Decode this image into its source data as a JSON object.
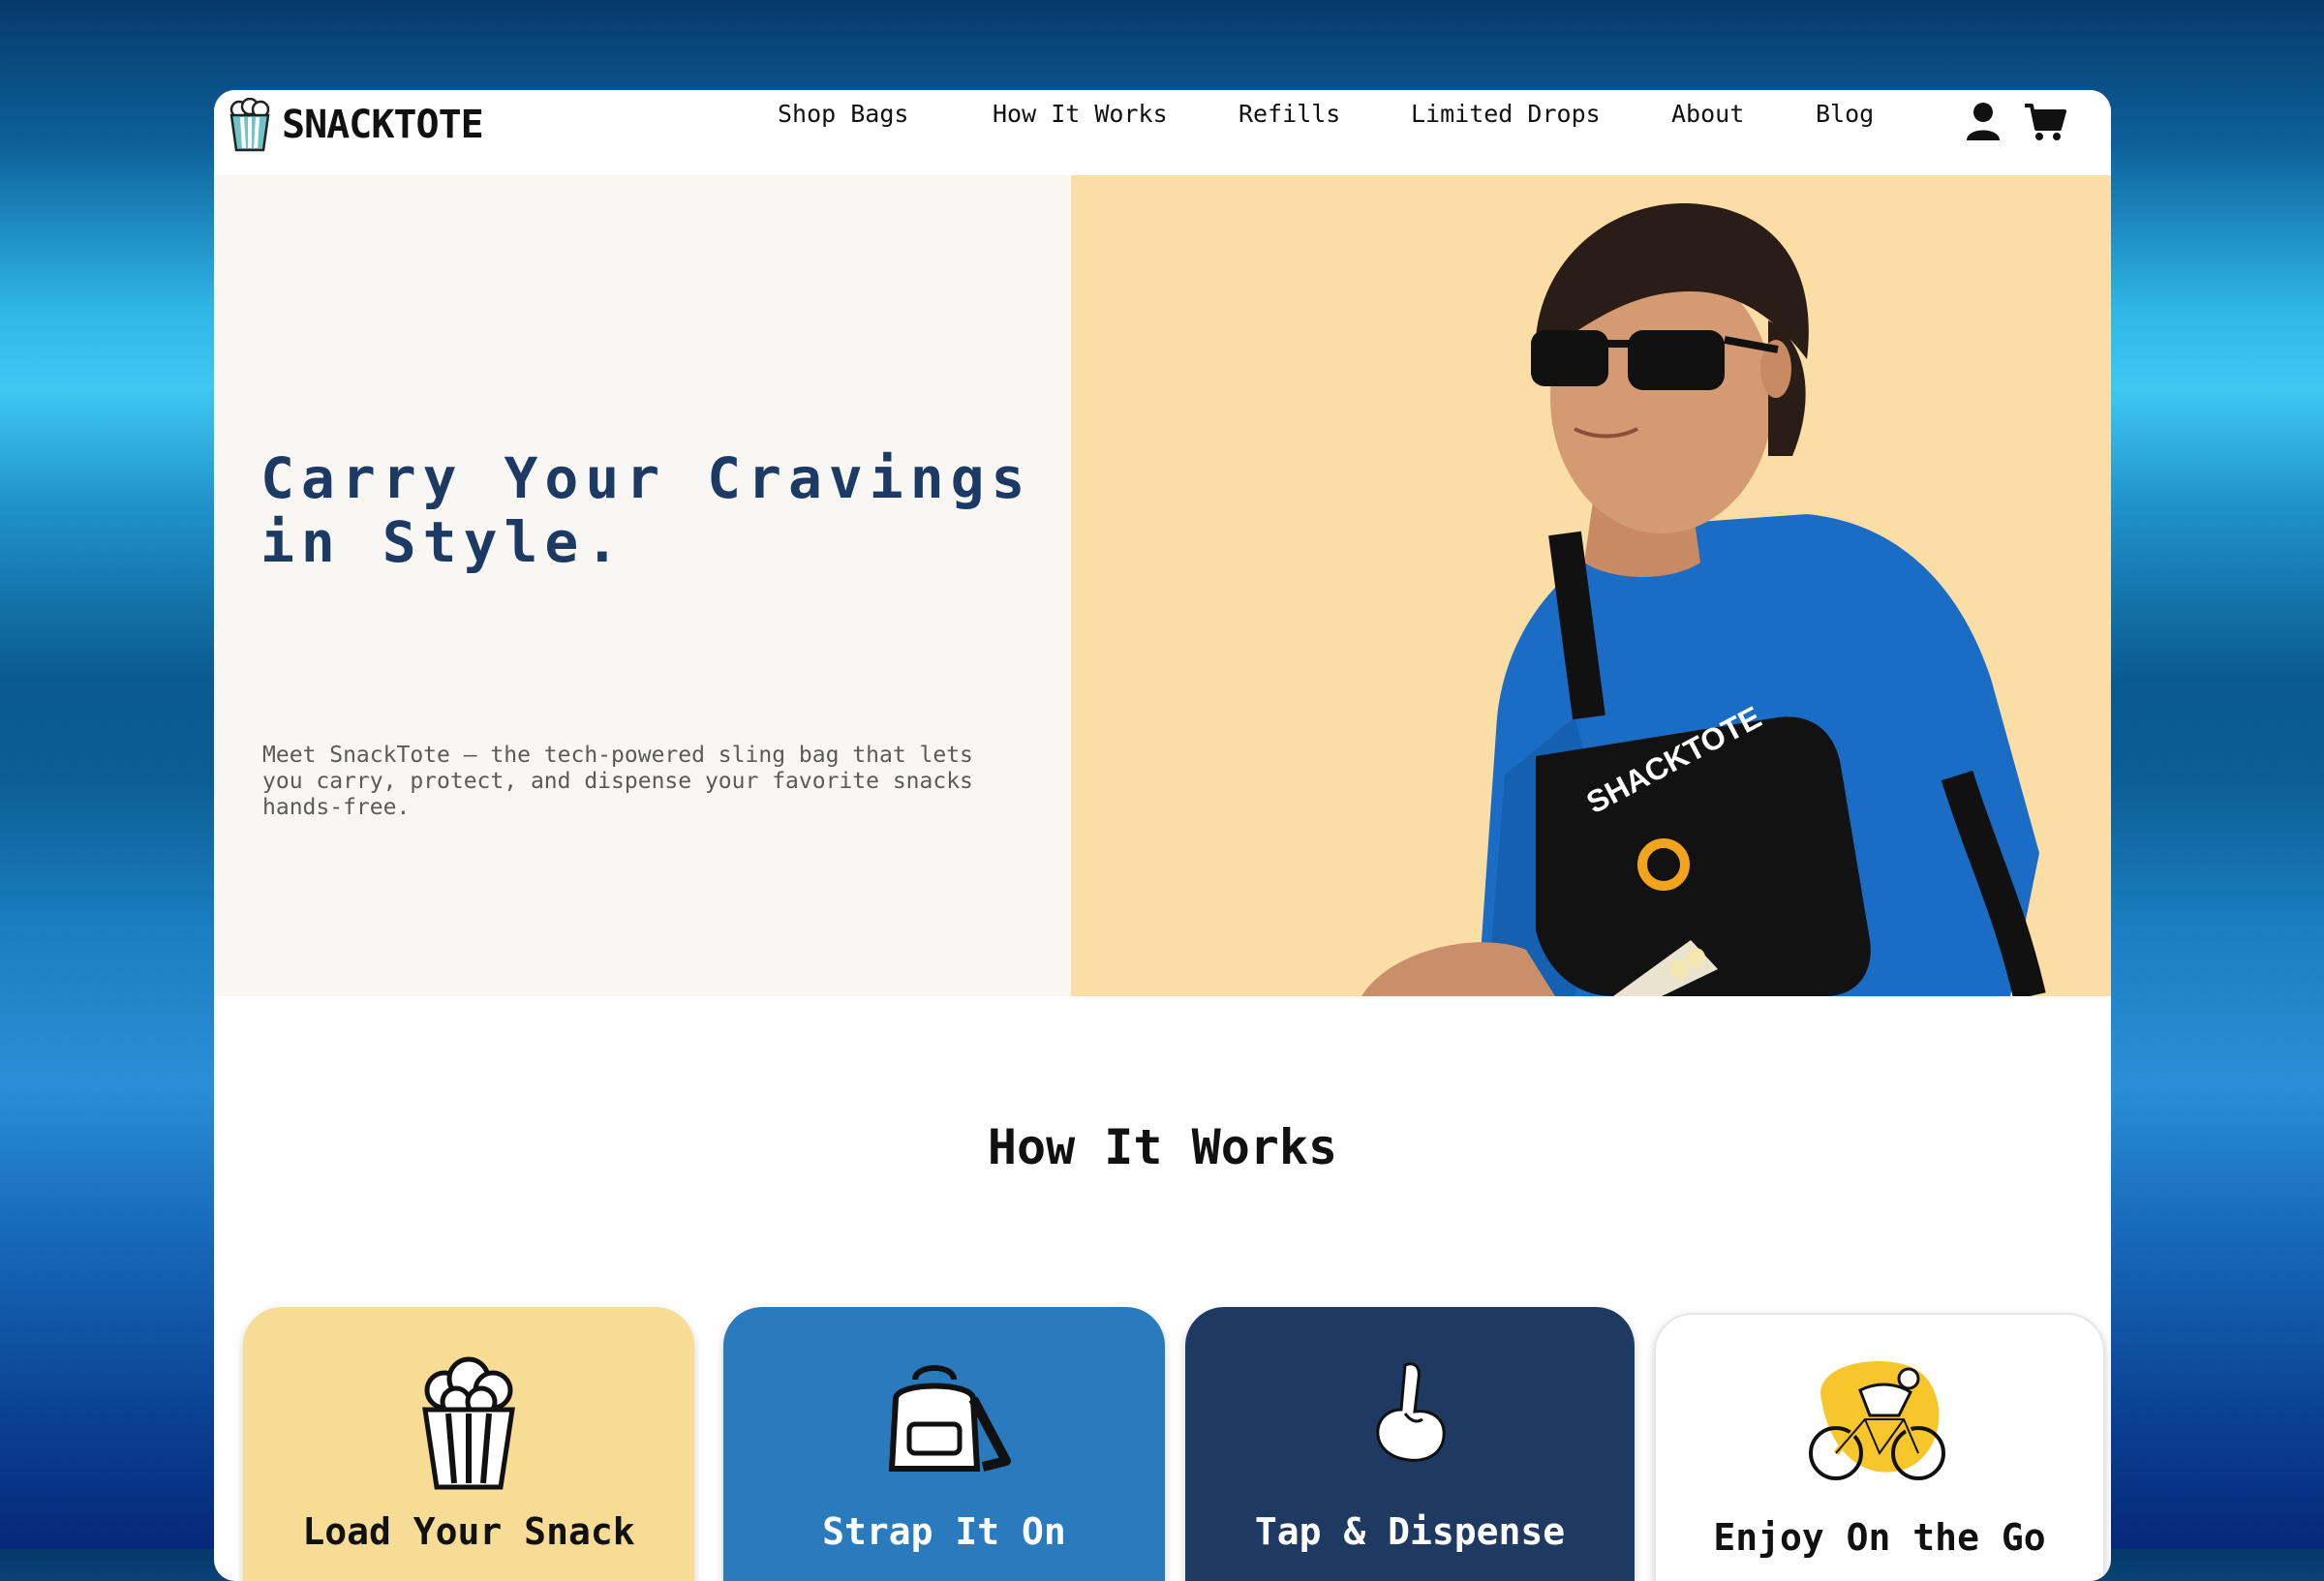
{
  "brand": {
    "name": "SNACKTOTE",
    "logo_icon": "popcorn-bucket-icon"
  },
  "nav": [
    "Shop Bags",
    "How It Works",
    "Refills",
    "Limited Drops",
    "About",
    "Blog"
  ],
  "header_icons": [
    "account-icon",
    "cart-icon"
  ],
  "hero": {
    "headline": "Carry Your Cravings in Style.",
    "subtext": "Meet SnackTote — the tech-powered sling bag that lets you carry, protect, and dispense your favorite snacks hands-free.",
    "image_bag_label": "SHACKTOTE",
    "accent": "#fbdda6",
    "headline_color": "#1c3a63"
  },
  "how_it_works": {
    "title": "How It Works",
    "steps": [
      {
        "title": "Load Your Snack",
        "icon": "popcorn-icon",
        "bg": "#f7dc95",
        "color": "#111111"
      },
      {
        "title": "Strap It On",
        "icon": "backpack-icon",
        "bg": "#2a7bbd",
        "color": "#ffffff"
      },
      {
        "title": "Tap & Dispense",
        "icon": "pointing-hand-icon",
        "bg": "#1e3a63",
        "color": "#ffffff"
      },
      {
        "title": "Enjoy On the Go",
        "icon": "cyclist-icon",
        "bg": "#ffffff",
        "color": "#111111"
      }
    ]
  }
}
